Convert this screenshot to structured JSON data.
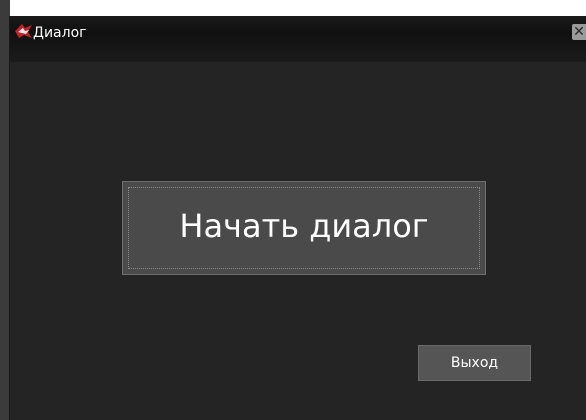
{
  "window": {
    "title": "Диалог",
    "close_glyph": "✕"
  },
  "main": {
    "start_dialog_label": "Начать диалог",
    "exit_label": "Выход"
  },
  "icons": {
    "app": "app-logo-icon",
    "close": "close-icon"
  },
  "colors": {
    "window_bg": "#242424",
    "titlebar_bg": "#111111",
    "button_bg": "#4a4a4a",
    "exit_bg": "#555555",
    "text": "#ffffff"
  }
}
